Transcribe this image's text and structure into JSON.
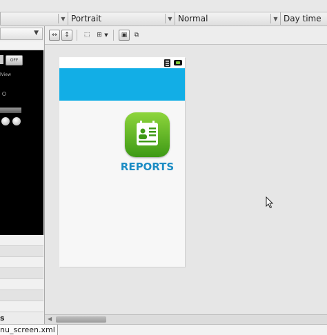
{
  "config_bar": {
    "orientation": "Portrait",
    "ui_mode": "Normal",
    "night_mode": "Day time"
  },
  "left_panel": {
    "switch_label": "OFF",
    "view_label": "lView",
    "section_label": "s"
  },
  "phone": {
    "appbar_color": "#12aee6",
    "reports_label": "REPORTS",
    "reports_color": "#1b8cc4"
  },
  "bottom": {
    "file_tab_label": "nu_screen.xml"
  }
}
